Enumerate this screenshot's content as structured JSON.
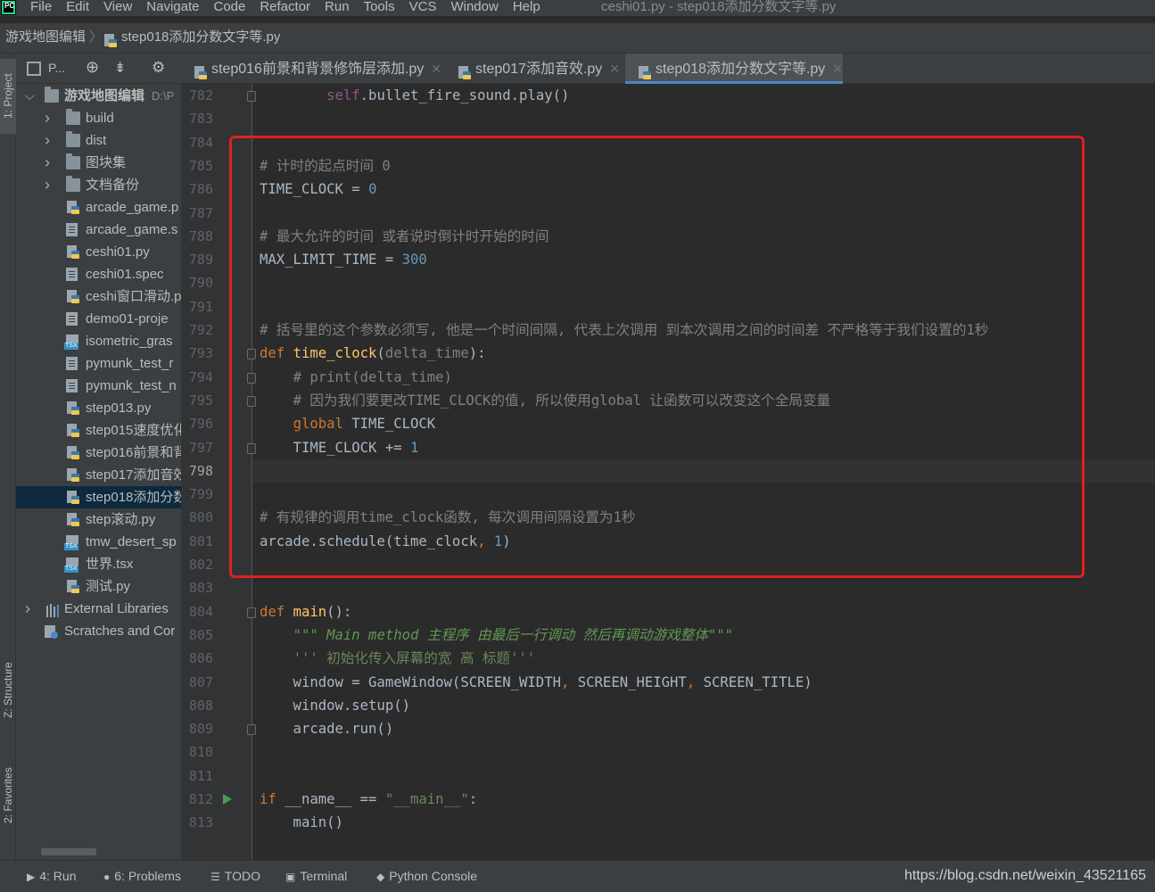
{
  "menu": {
    "items": [
      "File",
      "Edit",
      "View",
      "Navigate",
      "Code",
      "Refactor",
      "Run",
      "Tools",
      "VCS",
      "Window",
      "Help"
    ],
    "window_title": "ceshi01.py - step018添加分数文字等.py"
  },
  "breadcrumb": {
    "project": "游戏地图编辑",
    "file": "step018添加分数文字等.py"
  },
  "left_strip": {
    "project_tab": "1: Project",
    "structure_tab": "Z: Structure",
    "favorites_tab": "2: Favorites"
  },
  "project_panel": {
    "title": "P...",
    "tree": [
      {
        "label": "游戏地图编辑",
        "extra": "D:\\P",
        "icon": "folder-icon",
        "arrow": "open",
        "indent": 0
      },
      {
        "label": "build",
        "icon": "folder-icon",
        "arrow": "closed",
        "indent": 1
      },
      {
        "label": "dist",
        "icon": "folder-icon",
        "arrow": "closed",
        "indent": 1
      },
      {
        "label": "图块集",
        "icon": "folder-icon",
        "arrow": "closed",
        "indent": 1
      },
      {
        "label": "文档备份",
        "icon": "folder-icon",
        "arrow": "closed",
        "indent": 1
      },
      {
        "label": "arcade_game.p",
        "icon": "python-file-icon",
        "indent": 2
      },
      {
        "label": "arcade_game.s",
        "icon": "text-file-icon",
        "indent": 2
      },
      {
        "label": "ceshi01.py",
        "icon": "python-file-icon",
        "indent": 2
      },
      {
        "label": "ceshi01.spec",
        "icon": "text-file-icon",
        "indent": 2
      },
      {
        "label": "ceshi窗口滑动.p",
        "icon": "python-file-icon",
        "indent": 2
      },
      {
        "label": "demo01-proje",
        "icon": "text-file-icon",
        "indent": 2
      },
      {
        "label": "isometric_gras",
        "icon": "tsx-file-icon",
        "indent": 2
      },
      {
        "label": "pymunk_test_r",
        "icon": "text-file-icon",
        "indent": 2
      },
      {
        "label": "pymunk_test_n",
        "icon": "text-file-icon",
        "indent": 2
      },
      {
        "label": "step013.py",
        "icon": "python-file-icon",
        "indent": 2
      },
      {
        "label": "step015速度优化",
        "icon": "python-file-icon",
        "indent": 2
      },
      {
        "label": "step016前景和背",
        "icon": "python-file-icon",
        "indent": 2
      },
      {
        "label": "step017添加音效",
        "icon": "python-file-icon",
        "indent": 2
      },
      {
        "label": "step018添加分数",
        "icon": "python-file-icon",
        "indent": 2,
        "selected": true
      },
      {
        "label": "step滚动.py",
        "icon": "python-file-icon",
        "indent": 2
      },
      {
        "label": "tmw_desert_sp",
        "icon": "tsx-file-icon",
        "indent": 2
      },
      {
        "label": "世界.tsx",
        "icon": "tsx-file-icon",
        "indent": 2
      },
      {
        "label": "测试.py",
        "icon": "python-file-icon",
        "indent": 2
      },
      {
        "label": "External Libraries",
        "icon": "library-icon",
        "arrow": "closed",
        "indent": 0
      },
      {
        "label": "Scratches and Cor",
        "icon": "scratches-icon",
        "indent": 0
      }
    ]
  },
  "tabs": [
    {
      "label": "step016前景和背景修饰层添加.py",
      "active": false
    },
    {
      "label": "step017添加音效.py",
      "active": false
    },
    {
      "label": "step018添加分数文字等.py",
      "active": true
    }
  ],
  "editor": {
    "current_line": "798",
    "lines": [
      {
        "n": "782",
        "seg": [
          [
            "",
            "        "
          ],
          [
            "self",
            "self"
          ],
          [
            "txt",
            ".bullet_fire_sound.play()"
          ]
        ]
      },
      {
        "n": "783",
        "seg": []
      },
      {
        "n": "784",
        "seg": []
      },
      {
        "n": "785",
        "seg": [
          [
            "cm",
            "# 计时的起点时间 0"
          ]
        ]
      },
      {
        "n": "786",
        "seg": [
          [
            "txt",
            "TIME_CLOCK = "
          ],
          [
            "num",
            "0"
          ]
        ]
      },
      {
        "n": "787",
        "seg": []
      },
      {
        "n": "788",
        "seg": [
          [
            "cm",
            "# 最大允许的时间 或者说时倒计时开始的时间"
          ]
        ]
      },
      {
        "n": "789",
        "seg": [
          [
            "txt",
            "MAX_LIMIT_TIME = "
          ],
          [
            "num",
            "300"
          ]
        ]
      },
      {
        "n": "790",
        "seg": []
      },
      {
        "n": "791",
        "seg": []
      },
      {
        "n": "792",
        "seg": [
          [
            "cm",
            "# 括号里的这个参数必须写, 他是一个时间间隔, 代表上次调用 到本次调用之间的时间差 不严格等于我们设置的1秒"
          ]
        ]
      },
      {
        "n": "793",
        "seg": [
          [
            "kw",
            "def "
          ],
          [
            "fn",
            "time_clock"
          ],
          [
            "txt",
            "("
          ],
          [
            "par",
            "delta_time"
          ],
          [
            "txt",
            "):"
          ]
        ]
      },
      {
        "n": "794",
        "seg": [
          [
            "txt",
            "    "
          ],
          [
            "cm",
            "# print(delta_time)"
          ]
        ]
      },
      {
        "n": "795",
        "seg": [
          [
            "txt",
            "    "
          ],
          [
            "cm",
            "# 因为我们要更改TIME_CLOCK的值, 所以使用global 让函数可以改变这个全局变量"
          ]
        ]
      },
      {
        "n": "796",
        "seg": [
          [
            "txt",
            "    "
          ],
          [
            "kw",
            "global "
          ],
          [
            "txt",
            "TIME_CLOCK"
          ]
        ]
      },
      {
        "n": "797",
        "seg": [
          [
            "txt",
            "    TIME_CLOCK += "
          ],
          [
            "num",
            "1"
          ]
        ]
      },
      {
        "n": "798",
        "seg": []
      },
      {
        "n": "799",
        "seg": []
      },
      {
        "n": "800",
        "seg": [
          [
            "cm",
            "# 有规律的调用time_clock函数, 每次调用间隔设置为1秒"
          ]
        ]
      },
      {
        "n": "801",
        "seg": [
          [
            "txt",
            "arcade.schedule(time_clock"
          ],
          [
            "kw",
            ", "
          ],
          [
            "num",
            "1"
          ],
          [
            "txt",
            ")"
          ]
        ]
      },
      {
        "n": "802",
        "seg": []
      },
      {
        "n": "803",
        "seg": []
      },
      {
        "n": "804",
        "seg": [
          [
            "kw",
            "def "
          ],
          [
            "fn",
            "main"
          ],
          [
            "txt",
            "():"
          ]
        ]
      },
      {
        "n": "805",
        "seg": [
          [
            "txt",
            "    "
          ],
          [
            "doc",
            "\"\"\" Main method 主程序 由最后一行调动 然后再调动游戏整体\"\"\""
          ]
        ]
      },
      {
        "n": "806",
        "seg": [
          [
            "txt",
            "    "
          ],
          [
            "str",
            "''' 初始化传入屏幕的宽 高 标题'''"
          ]
        ]
      },
      {
        "n": "807",
        "seg": [
          [
            "txt",
            "    window = GameWindow(SCREEN_WIDTH"
          ],
          [
            "kw",
            ", "
          ],
          [
            "txt",
            "SCREEN_HEIGHT"
          ],
          [
            "kw",
            ", "
          ],
          [
            "txt",
            "SCREEN_TITLE)"
          ]
        ]
      },
      {
        "n": "808",
        "seg": [
          [
            "txt",
            "    window.setup()"
          ]
        ]
      },
      {
        "n": "809",
        "seg": [
          [
            "txt",
            "    arcade.run()"
          ]
        ]
      },
      {
        "n": "810",
        "seg": []
      },
      {
        "n": "811",
        "seg": []
      },
      {
        "n": "812",
        "seg": [
          [
            "kw",
            "if "
          ],
          [
            "txt",
            "__name__ == "
          ],
          [
            "str",
            "\"__main__\""
          ],
          [
            "txt",
            ":"
          ]
        ]
      },
      {
        "n": "813",
        "seg": [
          [
            "txt",
            "    main()"
          ]
        ]
      }
    ]
  },
  "bottom": {
    "run": "4: Run",
    "problems": "6: Problems",
    "todo": "TODO",
    "terminal": "Terminal",
    "python_console": "Python Console",
    "watermark": "https://blog.csdn.net/weixin_43521165"
  },
  "colors": {
    "highlight_box": "#e02020",
    "accent": "#4a88c7",
    "selection": "#0d293e"
  }
}
